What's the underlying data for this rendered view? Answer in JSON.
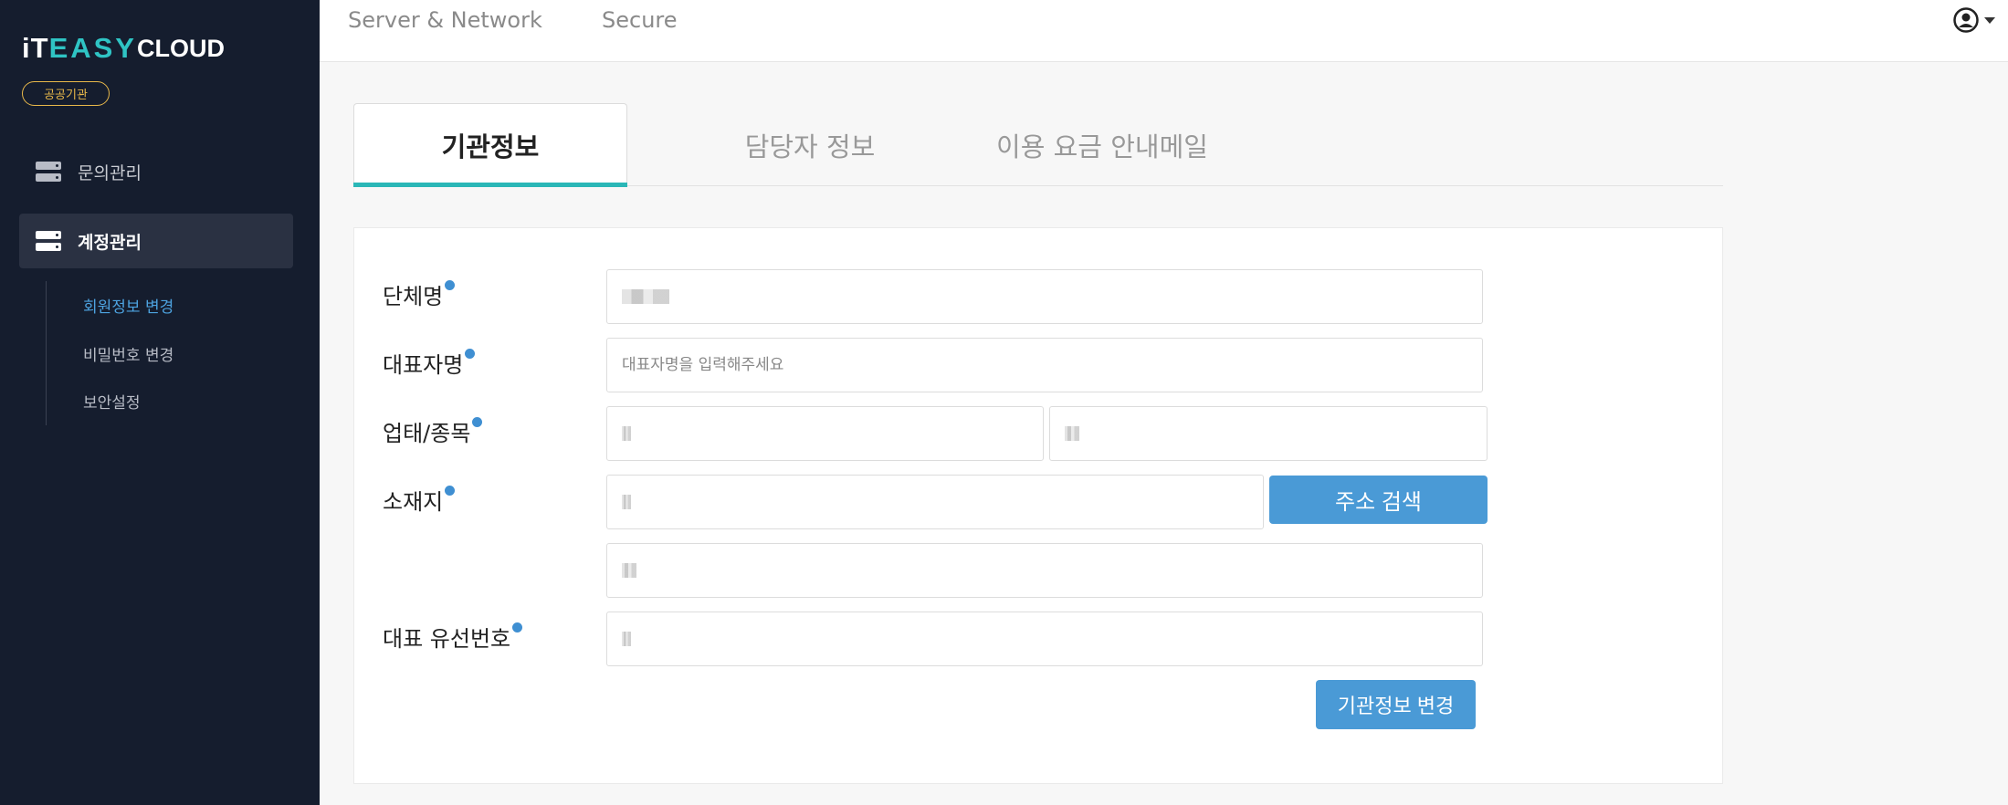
{
  "sidebar": {
    "logo": {
      "part1": "iT",
      "part2": "EASY",
      "part3": "CLOUD"
    },
    "badge": "공공기관",
    "nav": [
      {
        "label": "문의관리",
        "icon": "server-icon",
        "active": false
      },
      {
        "label": "계정관리",
        "icon": "server-icon",
        "active": true
      }
    ],
    "subnav": [
      {
        "label": "회원정보 변경",
        "active": true
      },
      {
        "label": "비밀번호 변경",
        "active": false
      },
      {
        "label": "보안설정",
        "active": false
      }
    ]
  },
  "topbar": {
    "links": [
      "Server & Network",
      "Secure"
    ],
    "user_icon": "user-circle-icon"
  },
  "tabs": [
    "기관정보",
    "담당자 정보",
    "이용 요금 안내메일"
  ],
  "form": {
    "org_name_label": "단체명",
    "rep_name_label": "대표자명",
    "rep_name_placeholder": "대표자명을 입력해주세요",
    "business_label": "업태/종목",
    "address_label": "소재지",
    "address_search_button": "주소 검색",
    "phone_label": "대표 유선번호",
    "submit_button": "기관정보 변경"
  },
  "colors": {
    "sidebar_bg": "#151d2e",
    "accent_teal": "#2ab7b7",
    "button_blue": "#4a9ad6",
    "badge_gold": "#e8b84a",
    "required_dot": "#3f8fd2"
  }
}
